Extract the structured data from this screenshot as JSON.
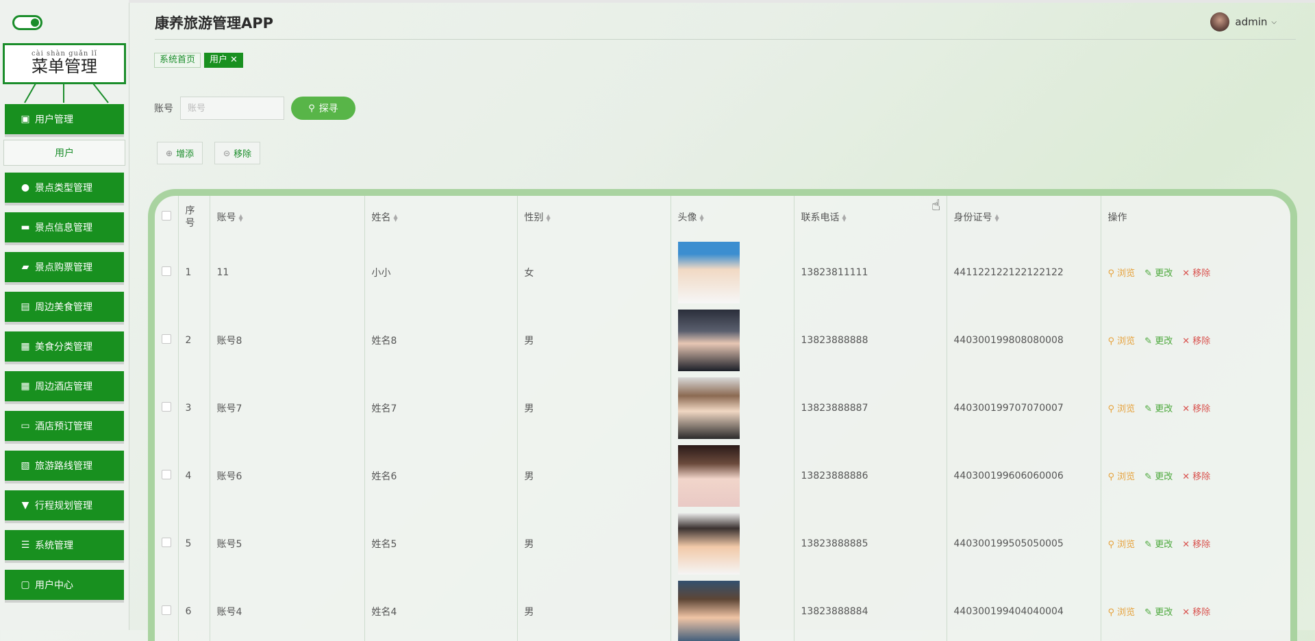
{
  "app": {
    "title": "康养旅游管理APP"
  },
  "user": {
    "name": "admin"
  },
  "sidebar": {
    "menu_title": "菜单管理",
    "menu_pinyin": "cài shàn guǎn lǐ",
    "items": [
      {
        "label": "用户管理",
        "icon": "clipboard-icon"
      },
      {
        "label": "用户",
        "sub": true
      },
      {
        "label": "景点类型管理",
        "icon": "person-icon"
      },
      {
        "label": "景点信息管理",
        "icon": "briefcase-icon"
      },
      {
        "label": "景点购票管理",
        "icon": "ticket-icon"
      },
      {
        "label": "周边美食管理",
        "icon": "clipboard-list-icon"
      },
      {
        "label": "美食分类管理",
        "icon": "printer-icon"
      },
      {
        "label": "周边酒店管理",
        "icon": "grid-icon"
      },
      {
        "label": "酒店预订管理",
        "icon": "monitor-icon"
      },
      {
        "label": "旅游路线管理",
        "icon": "clipboard-check-icon"
      },
      {
        "label": "行程规划管理",
        "icon": "stamp-icon"
      },
      {
        "label": "系统管理",
        "icon": "sliders-icon"
      },
      {
        "label": "用户中心",
        "icon": "wallet-icon"
      }
    ]
  },
  "tabs": [
    {
      "label": "系统首页",
      "active": false
    },
    {
      "label": "用户",
      "active": true
    }
  ],
  "search": {
    "label": "账号",
    "placeholder": "账号",
    "button": "探寻"
  },
  "actions": {
    "add": "增添",
    "remove": "移除"
  },
  "table": {
    "headers": [
      "序号",
      "账号",
      "姓名",
      "性别",
      "头像",
      "联系电话",
      "身份证号",
      "操作"
    ],
    "op_labels": {
      "view": "浏览",
      "edit": "更改",
      "delete": "移除"
    },
    "rows": [
      {
        "no": "1",
        "account": "11",
        "name": "小小",
        "gender": "女",
        "phone": "13823811111",
        "id_card": "441122122122122122"
      },
      {
        "no": "2",
        "account": "账号8",
        "name": "姓名8",
        "gender": "男",
        "phone": "13823888888",
        "id_card": "440300199808080008"
      },
      {
        "no": "3",
        "account": "账号7",
        "name": "姓名7",
        "gender": "男",
        "phone": "13823888887",
        "id_card": "440300199707070007"
      },
      {
        "no": "4",
        "account": "账号6",
        "name": "姓名6",
        "gender": "男",
        "phone": "13823888886",
        "id_card": "440300199606060006"
      },
      {
        "no": "5",
        "account": "账号5",
        "name": "姓名5",
        "gender": "男",
        "phone": "13823888885",
        "id_card": "440300199505050005"
      },
      {
        "no": "6",
        "account": "账号4",
        "name": "姓名4",
        "gender": "男",
        "phone": "13823888884",
        "id_card": "440300199404040004"
      }
    ]
  },
  "colors": {
    "primary": "#18901f",
    "search_button": "#58b548",
    "table_border": "#a9d3a0",
    "view": "#e6a23c",
    "edit": "#4ca83c",
    "delete": "#d9534f"
  }
}
